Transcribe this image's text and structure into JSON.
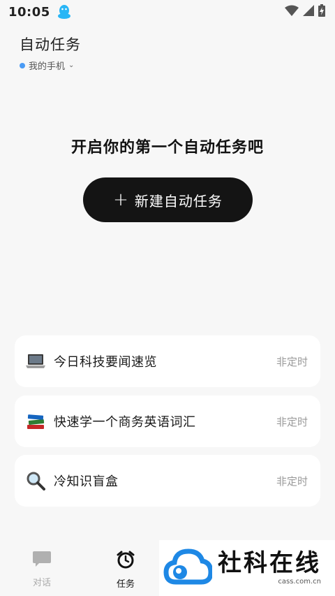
{
  "status": {
    "time": "10:05"
  },
  "header": {
    "title": "自动任务",
    "device": "我的手机"
  },
  "empty_state": {
    "title": "开启你的第一个自动任务吧",
    "create_label": "新建自动任务"
  },
  "tasks": [
    {
      "label": "今日科技要闻速览",
      "schedule": "非定时",
      "icon": "laptop-icon"
    },
    {
      "label": "快速学一个商务英语词汇",
      "schedule": "非定时",
      "icon": "books-icon"
    },
    {
      "label": "冷知识盲盒",
      "schedule": "非定时",
      "icon": "magnifier-icon"
    }
  ],
  "nav": {
    "chat": "对话",
    "tasks": "任务"
  },
  "watermark": {
    "name": "社科在线",
    "url": "cass.com.cn"
  },
  "colors": {
    "accent": "#4a9bf5",
    "button": "#141414",
    "nav_inactive": "#aaaaaa",
    "logo_blue": "#1e88e5"
  }
}
